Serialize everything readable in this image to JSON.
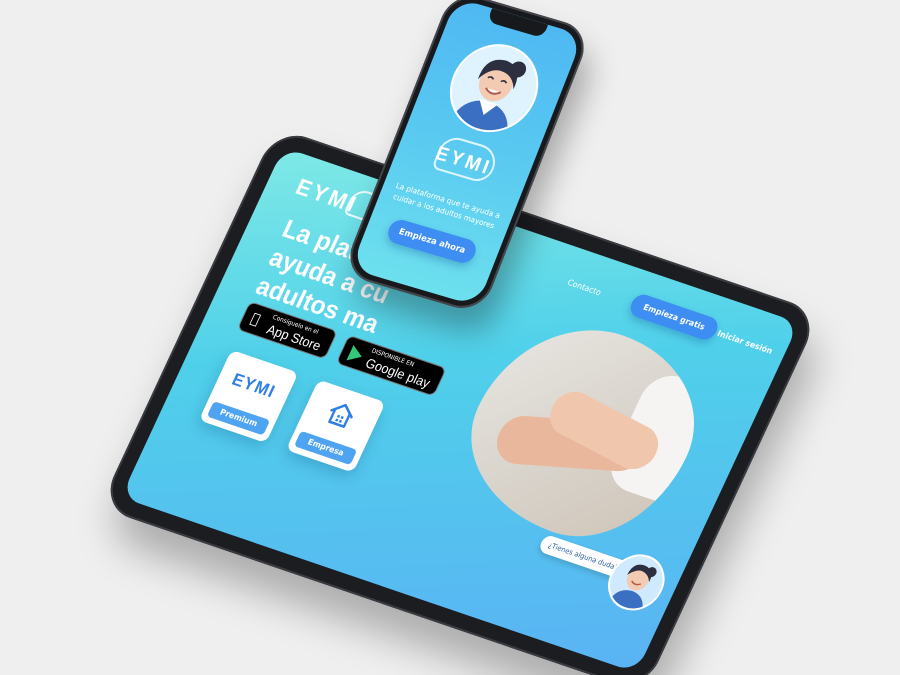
{
  "tablet": {
    "logo": "EYMI",
    "headline_lines": [
      "La plataforma",
      "ayuda a cu",
      "adultos ma"
    ],
    "app_store": {
      "small": "Consíguelo en el",
      "big": "App Store"
    },
    "google_play": {
      "small": "DISPONIBLE EN",
      "big": "Google play"
    },
    "tiles": [
      {
        "logo": "EYMI",
        "label": "Premium",
        "icon": "eymi-logo-icon"
      },
      {
        "logo": "",
        "label": "Empresa",
        "icon": "house-icon"
      }
    ],
    "nav": {
      "contacto": "Contacto",
      "cta": "Empieza gratis",
      "login": "Iniciar sesión"
    },
    "chat_prompt": "¿Tienes alguna duda?"
  },
  "phone": {
    "logo": "EYMI",
    "tagline_lines": [
      "La plataforma que te ayuda a",
      "cuidar a los adultos mayores"
    ],
    "cta": "Empieza ahora"
  },
  "colors": {
    "primary_blue": "#3d8df2",
    "cyan": "#4fd0ea",
    "background": "#efefef"
  }
}
